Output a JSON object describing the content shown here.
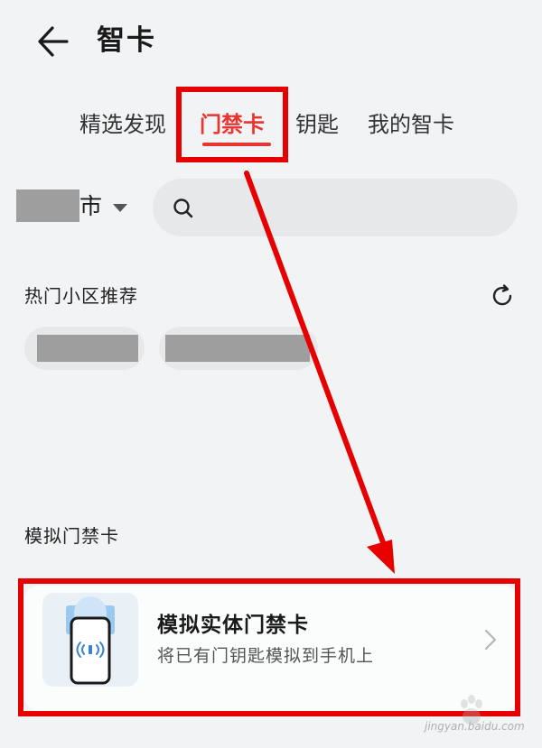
{
  "header": {
    "title": "智卡",
    "back_icon": "back-arrow-icon"
  },
  "tabs": [
    {
      "label": "精选发现",
      "active": false
    },
    {
      "label": "门禁卡",
      "active": true
    },
    {
      "label": "钥匙",
      "active": false
    },
    {
      "label": "我的智卡",
      "active": false
    }
  ],
  "city": {
    "label": "市",
    "icon": "caret-down-icon"
  },
  "search": {
    "placeholder": "",
    "icon": "search-icon"
  },
  "hot": {
    "title": "热门小区推荐",
    "refresh_icon": "refresh-icon"
  },
  "simulated": {
    "title": "模拟门禁卡",
    "card_title": "模拟实体门禁卡",
    "card_subtitle": "将已有门钥匙模拟到手机上",
    "illustration_icon": "phone-nfc-icon",
    "chevron_icon": "chevron-right-icon"
  },
  "colors": {
    "accent": "#e8352f",
    "annotation": "#e60000",
    "background": "#f1f3f5"
  },
  "watermark": {
    "text": "jingyan.baidu.com"
  }
}
